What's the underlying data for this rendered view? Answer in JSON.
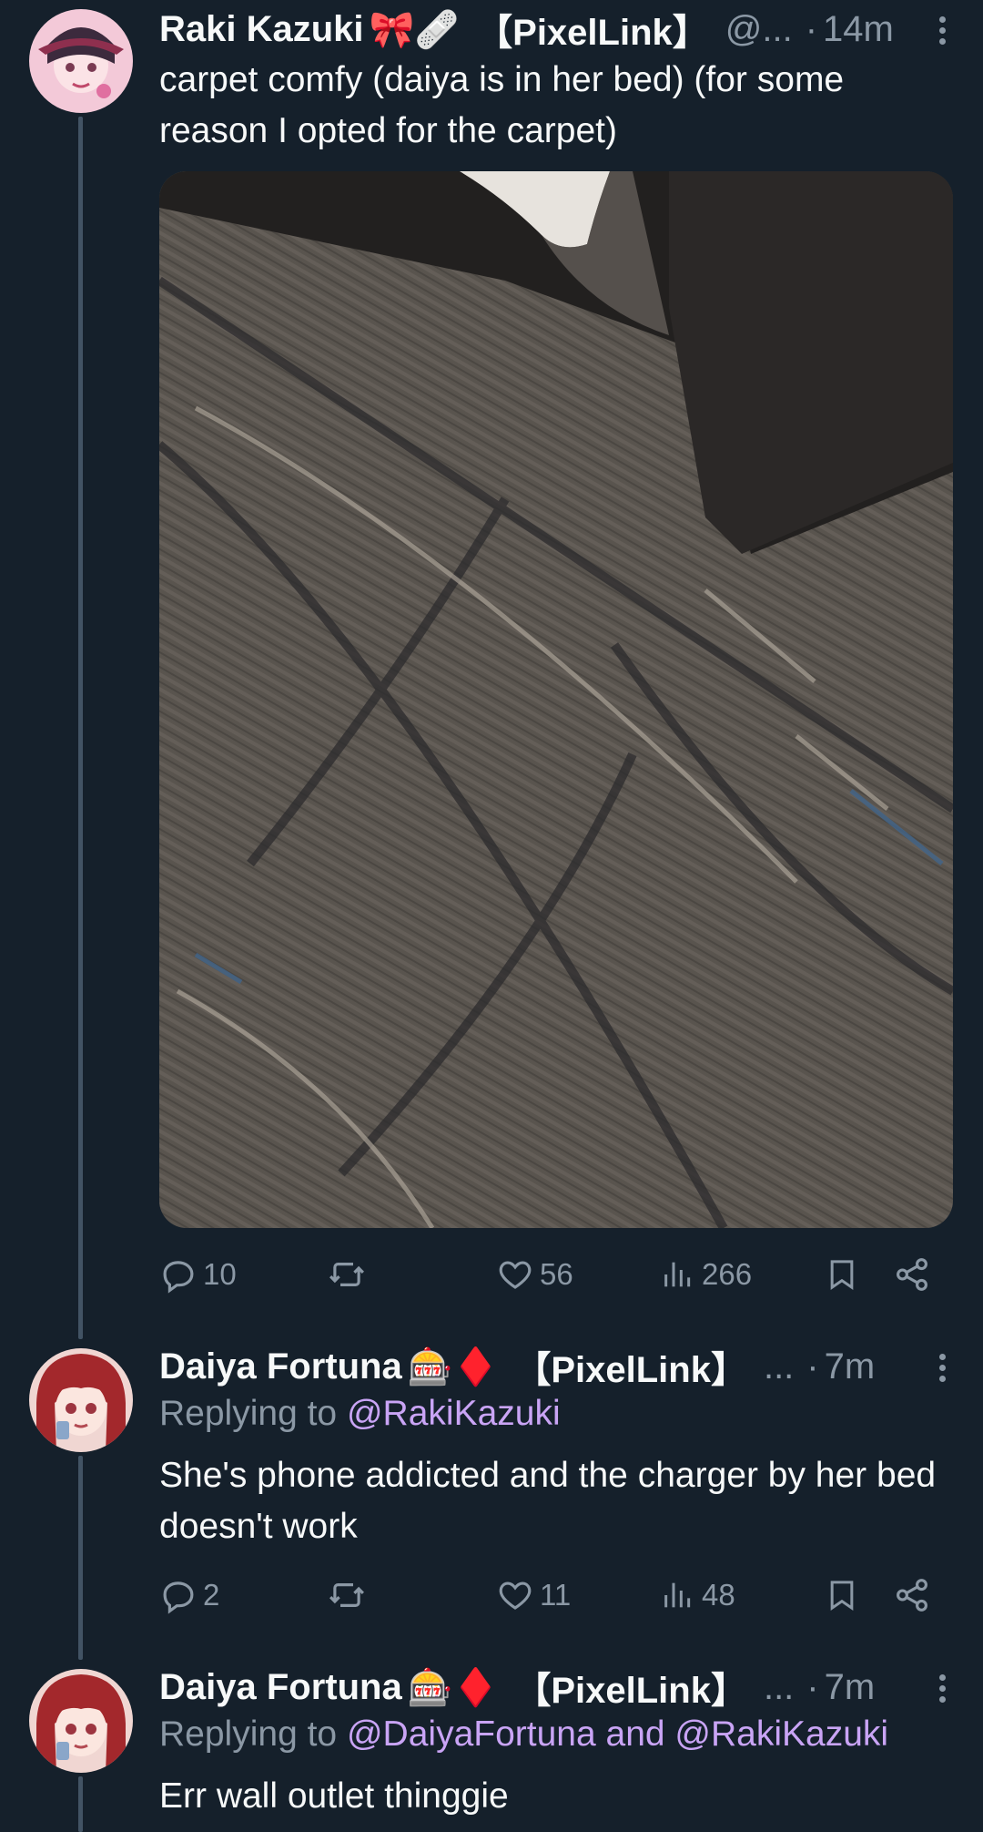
{
  "tweets": [
    {
      "name": "Raki Kazuki",
      "emoji": "🎀🩹",
      "org": "【PixelLink】",
      "handle": "@...",
      "dot": "·",
      "time": "14m",
      "text": "carpet comfy (daiya is in her bed) (for some reason I opted for the carpet)",
      "stats": {
        "replies": "10",
        "retweets": "",
        "likes": "56",
        "views": "266"
      }
    },
    {
      "name": "Daiya Fortuna",
      "emoji": "🎰♦️",
      "org": "【PixelLink】",
      "handle": "...",
      "dot": "·",
      "time": "7m",
      "replying_label": "Replying to",
      "replying_mentions": "@RakiKazuki",
      "text": "She's phone addicted and the charger by her bed doesn't work",
      "stats": {
        "replies": "2",
        "retweets": "",
        "likes": "11",
        "views": "48"
      }
    },
    {
      "name": "Daiya Fortuna",
      "emoji": "🎰♦️",
      "org": "【PixelLink】",
      "handle": "...",
      "dot": "·",
      "time": "7m",
      "replying_label": "Replying to",
      "replying_mentions": "@DaiyaFortuna and @RakiKazuki",
      "text": "Err wall outlet thinggie"
    }
  ],
  "colors": {
    "background": "#15202b",
    "text_primary": "#f7f9f9",
    "text_secondary": "#8b98a5",
    "mention": "#c9a4f5",
    "thread_line": "#425364"
  },
  "icons": [
    "more-icon",
    "reply-icon",
    "retweet-icon",
    "like-icon",
    "views-icon",
    "bookmark-icon",
    "share-icon"
  ]
}
